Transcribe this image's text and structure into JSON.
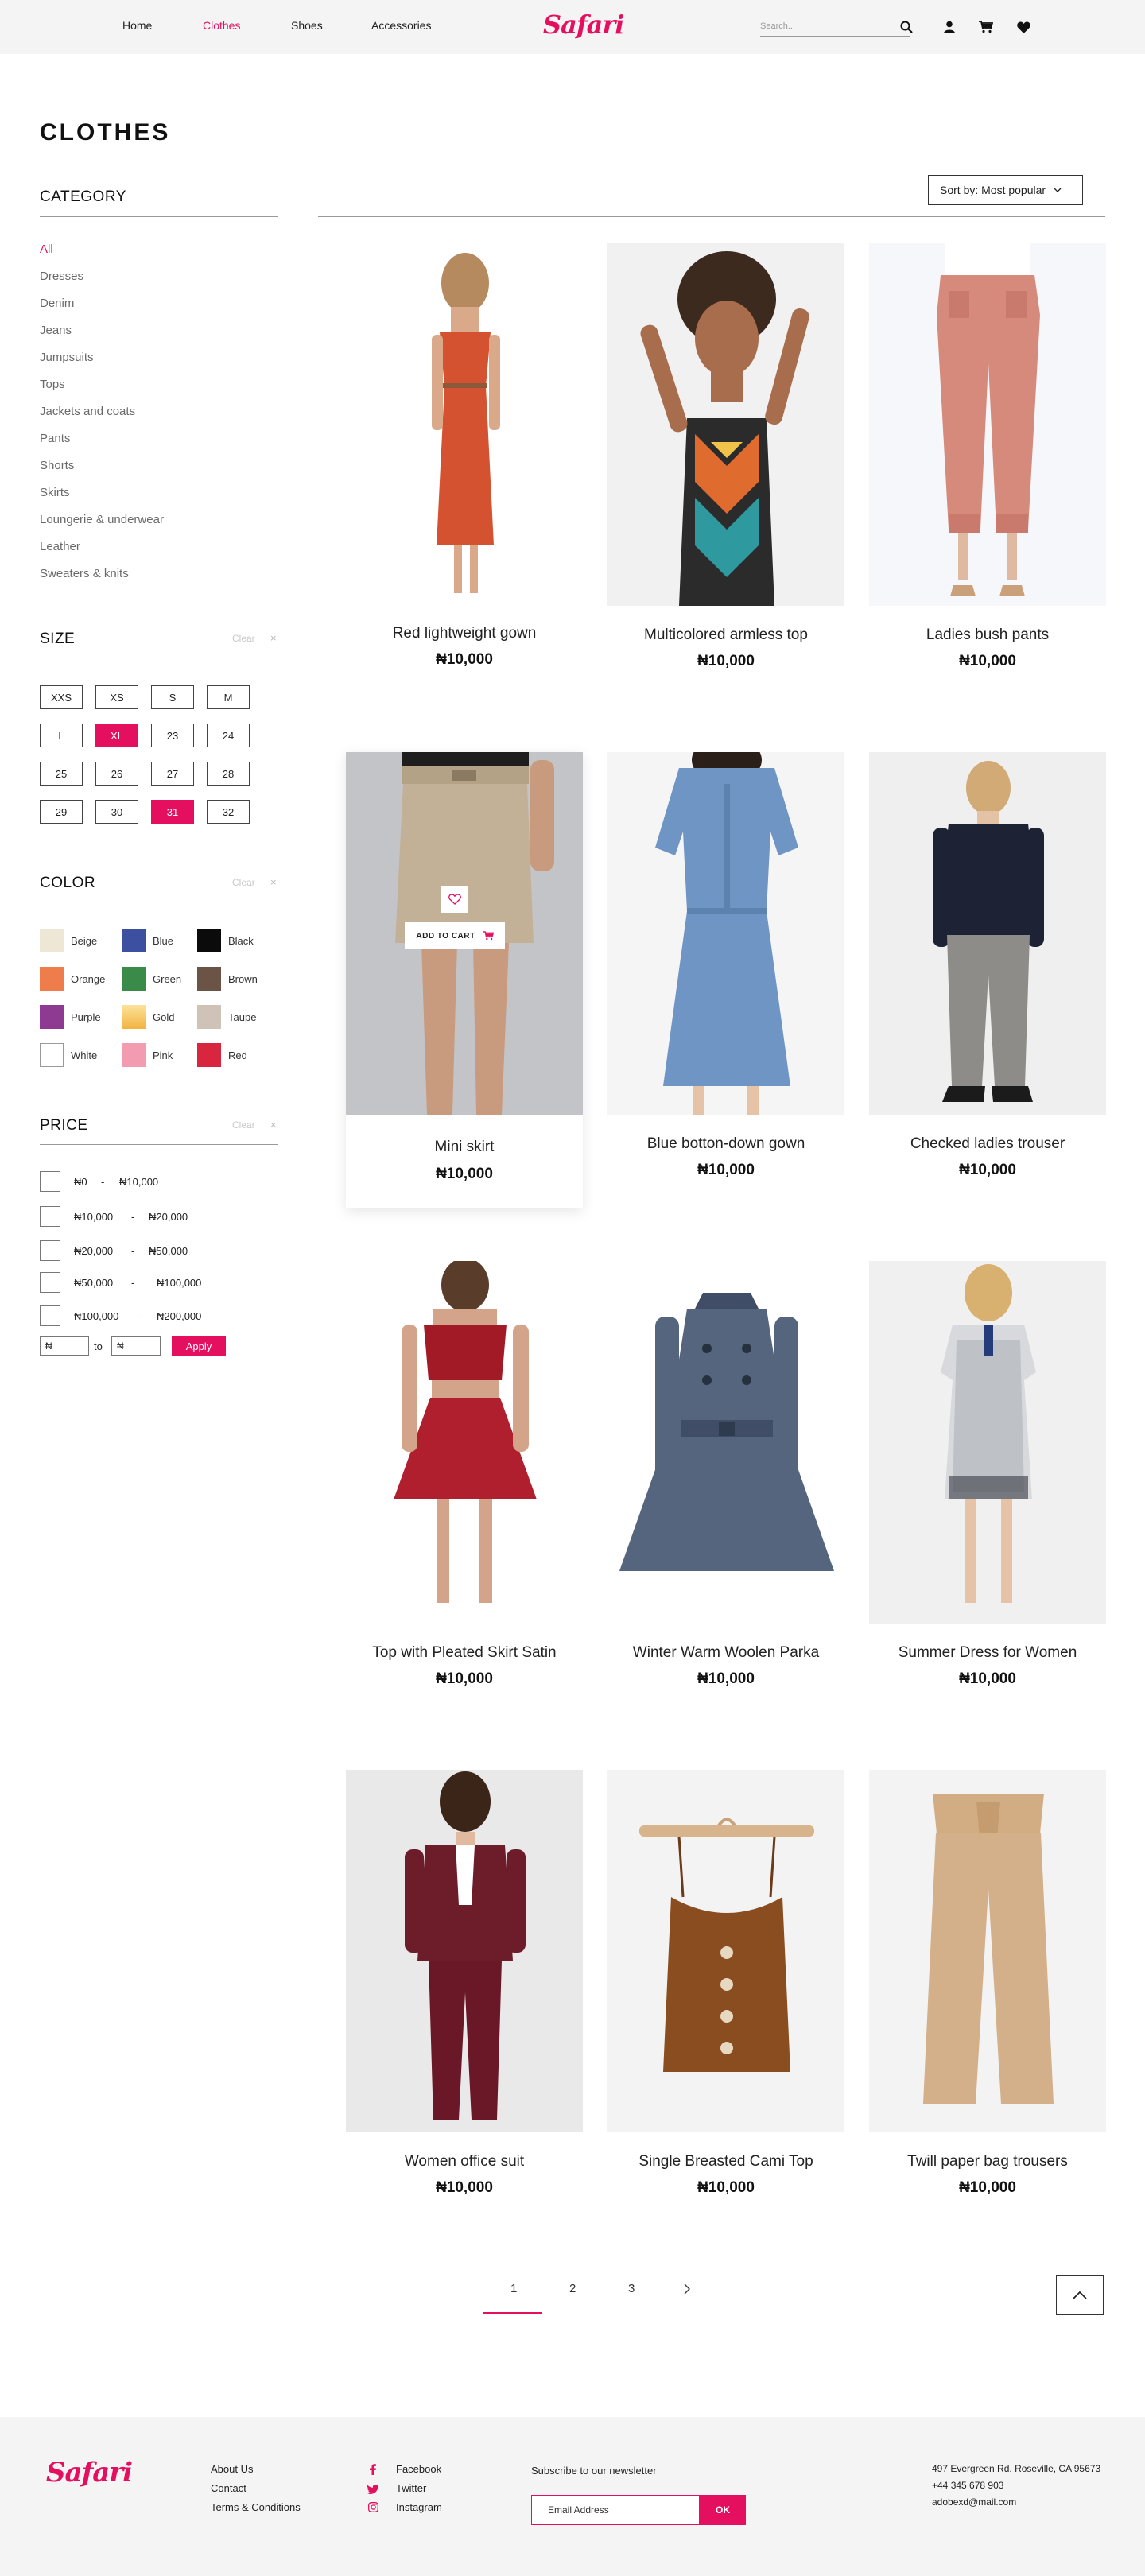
{
  "nav": {
    "links": [
      "Home",
      "Clothes",
      "Shoes",
      "Accessories"
    ],
    "active": "Clothes"
  },
  "brand": {
    "logo_text": "Safari",
    "accent_color": "#e4105f"
  },
  "search": {
    "placeholder": "Search..."
  },
  "header_icons": [
    "search-icon",
    "user-icon",
    "cart-icon",
    "heart-icon"
  ],
  "page_title": "CLOTHES",
  "sidebar": {
    "category": {
      "heading": "CATEGORY",
      "items": [
        "All",
        "Dresses",
        "Denim",
        "Jeans",
        "Jumpsuits",
        "Tops",
        "Jackets and coats",
        "Pants",
        "Shorts",
        "Skirts",
        "Loungerie & underwear",
        "Leather",
        "Sweaters & knits"
      ],
      "active": "All"
    },
    "size": {
      "heading": "SIZE",
      "clear_label": "Clear",
      "clear_x": "×",
      "options": [
        "XXS",
        "XS",
        "S",
        "M",
        "L",
        "XL",
        "23",
        "24",
        "25",
        "26",
        "27",
        "28",
        "29",
        "30",
        "31",
        "32"
      ],
      "selected": [
        "XL",
        "31"
      ]
    },
    "color": {
      "heading": "COLOR",
      "clear_label": "Clear",
      "clear_x": "×",
      "options": [
        {
          "name": "Beige",
          "hex": "#efe7d5"
        },
        {
          "name": "Blue",
          "hex": "#3d4fa0"
        },
        {
          "name": "Black",
          "hex": "#0b0b0b"
        },
        {
          "name": "Orange",
          "hex": "#ef7d4c"
        },
        {
          "name": "Green",
          "hex": "#3a8a4a"
        },
        {
          "name": "Brown",
          "hex": "#6b5346"
        },
        {
          "name": "Purple",
          "hex": "#8e3a92"
        },
        {
          "name": "Gold",
          "hex": "#f6c85a"
        },
        {
          "name": "Taupe",
          "hex": "#cfc3b7"
        },
        {
          "name": "White",
          "hex": "#ffffff"
        },
        {
          "name": "Pink",
          "hex": "#f39bb0"
        },
        {
          "name": "Red",
          "hex": "#d8263f"
        }
      ]
    },
    "price": {
      "heading": "PRICE",
      "clear_label": "Clear",
      "clear_x": "×",
      "ranges": [
        {
          "from": "₦0",
          "sep": "-",
          "to": "₦10,000"
        },
        {
          "from": "₦10,000",
          "sep": "-",
          "to": "₦20,000"
        },
        {
          "from": "₦20,000",
          "sep": "-",
          "to": "₦50,000"
        },
        {
          "from": "₦50,000",
          "sep": "-",
          "to": "₦100,000"
        },
        {
          "from": "₦100,000",
          "sep": "-",
          "to": "₦200,000"
        }
      ],
      "min_value": "₦",
      "to_label": "to",
      "max_value": "₦",
      "apply_label": "Apply"
    }
  },
  "sort": {
    "label": "Sort by: Most popular"
  },
  "products": [
    {
      "name": "Red lightweight gown",
      "price": "₦10,000"
    },
    {
      "name": "Multicolored armless top",
      "price": "₦10,000"
    },
    {
      "name": "Ladies bush pants",
      "price": "₦10,000"
    },
    {
      "name": "Mini skirt",
      "price": "₦10,000",
      "add_to_cart": "ADD TO CART"
    },
    {
      "name": "Blue botton-down gown",
      "price": "₦10,000"
    },
    {
      "name": "Checked ladies trouser",
      "price": "₦10,000"
    },
    {
      "name": "Top with Pleated Skirt Satin",
      "price": "₦10,000"
    },
    {
      "name": "Winter Warm Woolen Parka",
      "price": "₦10,000"
    },
    {
      "name": "Summer Dress for Women",
      "price": "₦10,000"
    },
    {
      "name": "Women office suit",
      "price": "₦10,000"
    },
    {
      "name": "Single Breasted Cami Top",
      "price": "₦10,000"
    },
    {
      "name": "Twill paper bag trousers",
      "price": "₦10,000"
    }
  ],
  "pagination": {
    "pages": [
      "1",
      "2",
      "3"
    ],
    "active": "1"
  },
  "footer": {
    "links": [
      "About Us",
      "Contact",
      "Terms & Conditions"
    ],
    "social": [
      {
        "name": "Facebook",
        "icon": "facebook-icon"
      },
      {
        "name": "Twitter",
        "icon": "twitter-icon"
      },
      {
        "name": "Instagram",
        "icon": "instagram-icon"
      }
    ],
    "newsletter": {
      "title": "Subscribe to our newsletter",
      "placeholder": "Email Address",
      "button": "OK"
    },
    "address": "497 Evergreen Rd. Roseville, CA 95673",
    "phone": "+44 345 678 903",
    "email": "adobexd@mail.com"
  }
}
